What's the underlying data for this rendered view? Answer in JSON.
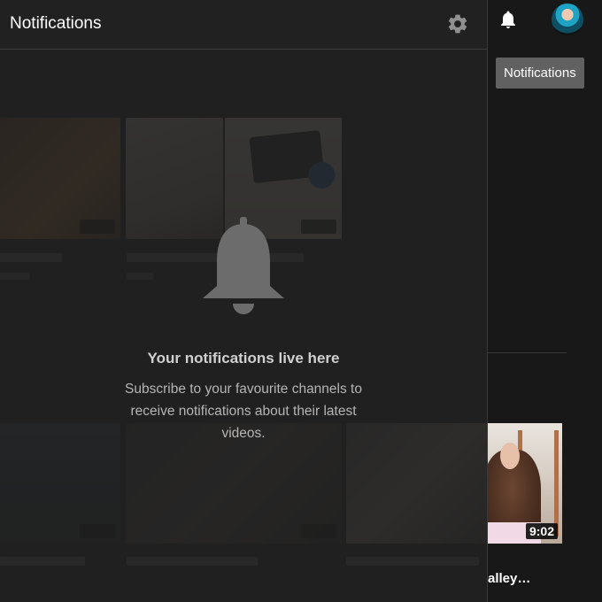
{
  "panel": {
    "title": "Notifications",
    "settings_icon": "gear-icon",
    "empty_state": {
      "icon": "bell-icon",
      "heading": "Your notifications live here",
      "description": "Subscribe to your favourite channels to receive notifications about their latest videos."
    }
  },
  "topbar": {
    "notifications_icon": "bell-icon",
    "avatar": "user-avatar"
  },
  "tooltip": {
    "text": "Notifications"
  },
  "sidebar_video": {
    "duration": "9:02",
    "title_fragment": "alley…"
  },
  "colors": {
    "panel_bg": "#212121",
    "page_bg": "#181818",
    "tooltip_bg": "#616161",
    "icon_gray": "#909090"
  }
}
